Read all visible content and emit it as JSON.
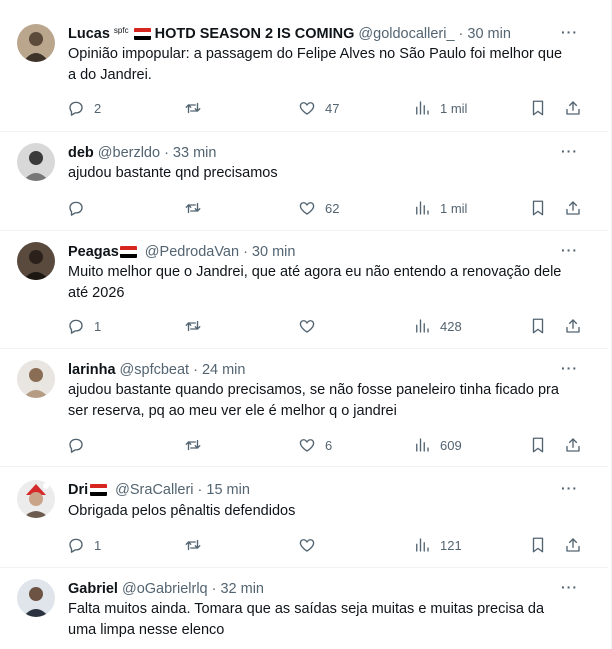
{
  "tweets": [
    {
      "name": "Lucas",
      "name_sup": "spfc",
      "name_suffix": "HOTD SEASON 2 IS COMING",
      "handle": "@goldocalleri_",
      "time": "30 min",
      "text": "Opinião impopular: a passagem do Felipe Alves no São Paulo foi melhor que a do Jandrei.",
      "replies": "2",
      "retweets": "",
      "likes": "47",
      "views": "1 mil"
    },
    {
      "name": "deb",
      "handle": "@berzldo",
      "time": "33 min",
      "text": "ajudou bastante qnd precisamos",
      "replies": "",
      "retweets": "",
      "likes": "62",
      "views": "1 mil"
    },
    {
      "name": "Peagas",
      "handle": "@PedrodaVan",
      "time": "30 min",
      "text": "Muito melhor que o Jandrei, que até agora eu não entendo a renovação dele até 2026",
      "replies": "1",
      "retweets": "",
      "likes": "",
      "views": "428"
    },
    {
      "name": "larinha",
      "handle": "@spfcbeat",
      "time": "24 min",
      "text": "ajudou bastante quando precisamos, se não fosse paneleiro tinha ficado pra ser reserva, pq ao meu ver ele é melhor q o jandrei",
      "replies": "",
      "retweets": "",
      "likes": "6",
      "views": "609"
    },
    {
      "name": "Dri",
      "handle": "@SraCalleri",
      "time": "15 min",
      "text": "Obrigada pelos pênaltis defendidos",
      "replies": "1",
      "retweets": "",
      "likes": "",
      "views": "121"
    },
    {
      "name": "Gabriel",
      "handle": "@oGabrielrlq",
      "time": "32 min",
      "text": "Falta muitos ainda. Tomara que as saídas seja muitas e muitas precisa da uma limpa nesse elenco"
    }
  ],
  "dot": "·",
  "more": "···",
  "icons": {
    "reply": "reply-icon",
    "retweet": "retweet-icon",
    "like": "heart-icon",
    "views": "views-icon",
    "bookmark": "bookmark-icon",
    "share": "share-icon"
  },
  "colors": {
    "text": "#0f1419",
    "secondary": "#536471",
    "border": "#eff3f4",
    "flag_red": "#d7261f"
  }
}
